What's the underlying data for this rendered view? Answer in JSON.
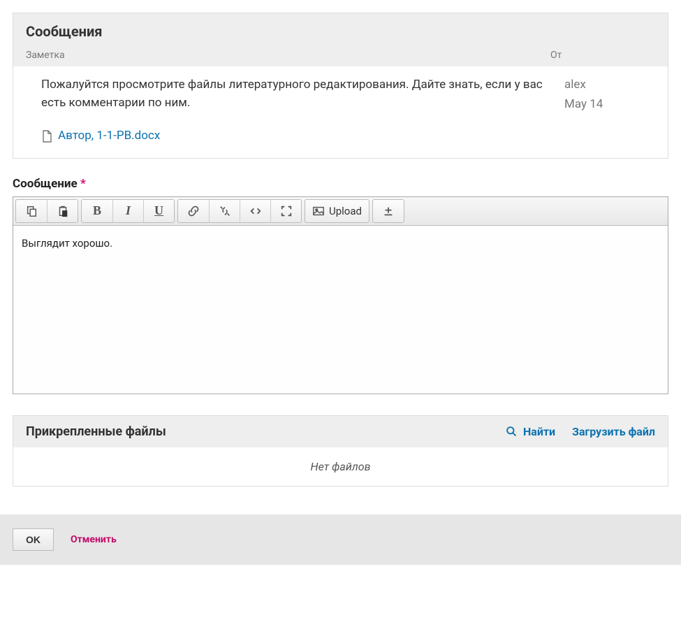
{
  "messages": {
    "title": "Сообщения",
    "columns": {
      "note": "Заметка",
      "from": "От"
    },
    "item": {
      "text": "Пожалуйтся просмотрите файлы литературного редактирования. Дайте знать, если у вас есть комментарии по ним.",
      "fileName": "Автор, 1-1-PB.docx",
      "author": "alex",
      "date": "May 14"
    }
  },
  "editor": {
    "label": "Сообщение",
    "uploadLabel": "Upload",
    "content": "Выглядит хорошо."
  },
  "attachments": {
    "title": "Прикрепленные файлы",
    "findLabel": "Найти",
    "uploadLabel": "Загрузить файл",
    "emptyText": "Нет файлов"
  },
  "footer": {
    "ok": "OK",
    "cancel": "Отменить"
  }
}
